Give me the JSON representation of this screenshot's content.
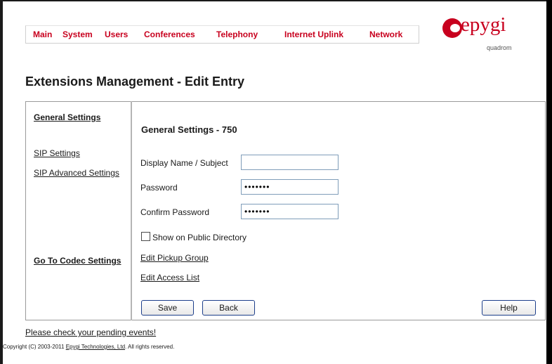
{
  "menu": [
    {
      "label": "Main"
    },
    {
      "label": "System"
    },
    {
      "label": "Users"
    },
    {
      "label": "Conferences"
    },
    {
      "label": "Telephony"
    },
    {
      "label": "Internet Uplink"
    },
    {
      "label": "Network"
    }
  ],
  "logo": {
    "word": "epygi",
    "sub": "quadrom"
  },
  "page_title": "Extensions Management - Edit Entry",
  "sidebar": {
    "general_settings": "General Settings",
    "sip_settings": "SIP Settings",
    "sip_advanced_settings": "SIP Advanced Settings",
    "codec_settings": "Go To Codec Settings"
  },
  "main": {
    "section_title": "General Settings - 750",
    "display_name": {
      "label": "Display Name / Subject",
      "value": ""
    },
    "password": {
      "label": "Password",
      "value": "•••••••"
    },
    "confirm_password": {
      "label": "Confirm Password",
      "value": "•••••••"
    },
    "show_public_directory": {
      "label": "Show on Public Directory",
      "checked": false
    },
    "edit_pickup_group": "Edit Pickup Group",
    "edit_access_list": "Edit Access List"
  },
  "buttons": {
    "save": "Save",
    "back": "Back",
    "help": "Help"
  },
  "footer": {
    "pending_events": "Please check your pending events!",
    "copyright_prefix": "Copyright (C) 2003-2011 ",
    "copyright_link": "Epygi Technologies, Ltd",
    "copyright_suffix": ". All rights reserved."
  },
  "colors": {
    "menu_text": "#c8001e",
    "logo": "#c8001e",
    "button_border": "#1c3e8a"
  }
}
